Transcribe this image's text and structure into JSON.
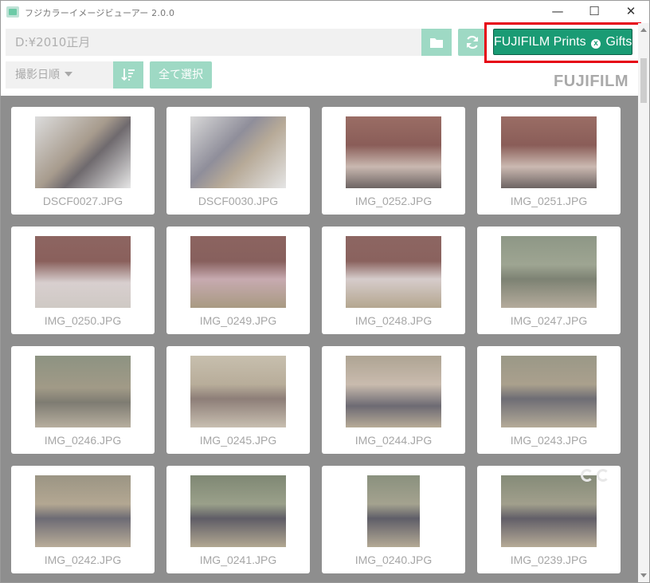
{
  "window": {
    "title": "フジカラーイメージビューアー 2.0.0",
    "min_icon": "—",
    "max_icon": "☐",
    "close_icon": "✕"
  },
  "toolbar": {
    "path": "D:¥2010正月",
    "fujifilm_button": {
      "text_before": "FUJIFILM Prints ",
      "x_glyph": "x",
      "text_after": " Gifts"
    },
    "sort_label": "撮影日順",
    "select_all": "全て選択",
    "logo": "FUJIFILM"
  },
  "colors": {
    "accent_light": "#9ed9c4",
    "fujifilm_green": "#1a9b74",
    "highlight_red": "#e60012",
    "gallery_bg": "#8e8e8e"
  },
  "images": [
    {
      "name": "DSCF0027.JPG"
    },
    {
      "name": "DSCF0030.JPG"
    },
    {
      "name": "IMG_0252.JPG"
    },
    {
      "name": "IMG_0251.JPG"
    },
    {
      "name": "IMG_0250.JPG"
    },
    {
      "name": "IMG_0249.JPG"
    },
    {
      "name": "IMG_0248.JPG"
    },
    {
      "name": "IMG_0247.JPG"
    },
    {
      "name": "IMG_0246.JPG"
    },
    {
      "name": "IMG_0245.JPG"
    },
    {
      "name": "IMG_0244.JPG"
    },
    {
      "name": "IMG_0243.JPG"
    },
    {
      "name": "IMG_0242.JPG"
    },
    {
      "name": "IMG_0241.JPG"
    },
    {
      "name": "IMG_0240.JPG"
    },
    {
      "name": "IMG_0239.JPG"
    }
  ]
}
